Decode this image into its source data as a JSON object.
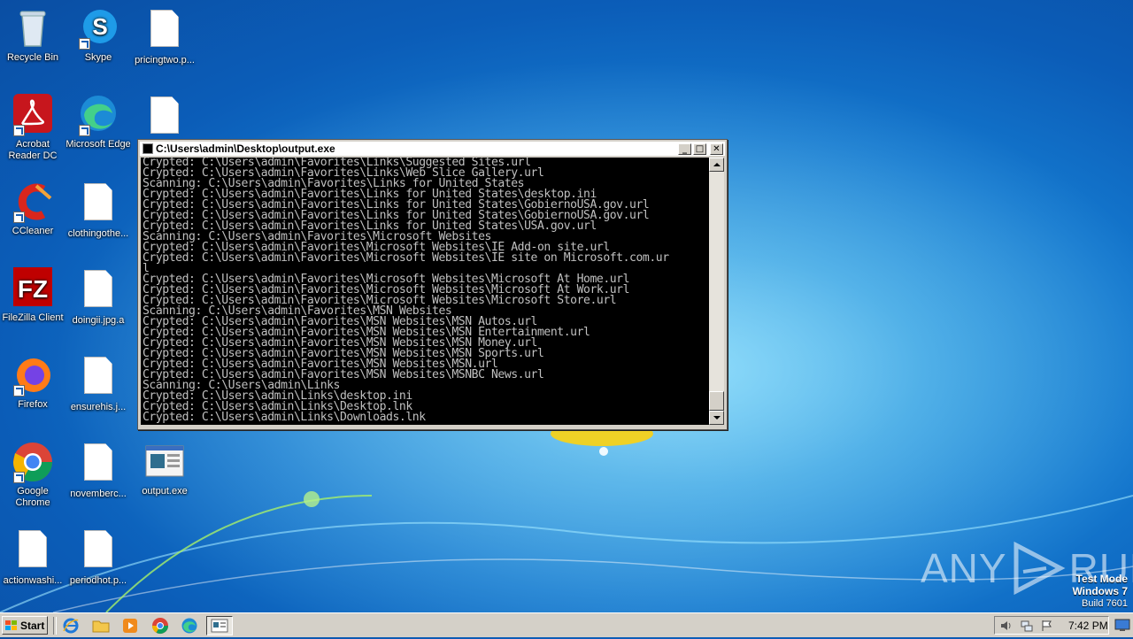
{
  "desktop": {
    "icons": [
      {
        "label": "Recycle Bin"
      },
      {
        "label": "Skype"
      },
      {
        "label": "pricingtwo.p..."
      },
      {
        "label": "Acrobat Reader DC"
      },
      {
        "label": "Microsoft Edge"
      },
      {
        "label": "CCleaner"
      },
      {
        "label": "clothingothe..."
      },
      {
        "label": "FileZilla Client"
      },
      {
        "label": "doingii.jpg.a"
      },
      {
        "label": "Firefox"
      },
      {
        "label": "ensurehis.j..."
      },
      {
        "label": "Google Chrome"
      },
      {
        "label": "novemberc..."
      },
      {
        "label": "output.exe"
      },
      {
        "label": "actionwashi..."
      },
      {
        "label": "periodhot.p..."
      }
    ]
  },
  "console": {
    "title": "C:\\Users\\admin\\Desktop\\output.exe",
    "lines": [
      "Crypted: C:\\Users\\admin\\Favorites\\Links\\Suggested Sites.url",
      "Crypted: C:\\Users\\admin\\Favorites\\Links\\Web Slice Gallery.url",
      "Scanning: C:\\Users\\admin\\Favorites\\Links for United States",
      "Crypted: C:\\Users\\admin\\Favorites\\Links for United States\\desktop.ini",
      "Crypted: C:\\Users\\admin\\Favorites\\Links for United States\\GobiernoUSA.gov.url",
      "Crypted: C:\\Users\\admin\\Favorites\\Links for United States\\GobiernoUSA.gov.url",
      "Crypted: C:\\Users\\admin\\Favorites\\Links for United States\\USA.gov.url",
      "Scanning: C:\\Users\\admin\\Favorites\\Microsoft Websites",
      "Crypted: C:\\Users\\admin\\Favorites\\Microsoft Websites\\IE Add-on site.url",
      "Crypted: C:\\Users\\admin\\Favorites\\Microsoft Websites\\IE site on Microsoft.com.ur",
      "l",
      "Crypted: C:\\Users\\admin\\Favorites\\Microsoft Websites\\Microsoft At Home.url",
      "Crypted: C:\\Users\\admin\\Favorites\\Microsoft Websites\\Microsoft At Work.url",
      "Crypted: C:\\Users\\admin\\Favorites\\Microsoft Websites\\Microsoft Store.url",
      "Scanning: C:\\Users\\admin\\Favorites\\MSN Websites",
      "Crypted: C:\\Users\\admin\\Favorites\\MSN Websites\\MSN Autos.url",
      "Crypted: C:\\Users\\admin\\Favorites\\MSN Websites\\MSN Entertainment.url",
      "Crypted: C:\\Users\\admin\\Favorites\\MSN Websites\\MSN Money.url",
      "Crypted: C:\\Users\\admin\\Favorites\\MSN Websites\\MSN Sports.url",
      "Crypted: C:\\Users\\admin\\Favorites\\MSN Websites\\MSN.url",
      "Crypted: C:\\Users\\admin\\Favorites\\MSN Websites\\MSNBC News.url",
      "Scanning: C:\\Users\\admin\\Links",
      "Crypted: C:\\Users\\admin\\Links\\desktop.ini",
      "Crypted: C:\\Users\\admin\\Links\\Desktop.lnk",
      "Crypted: C:\\Users\\admin\\Links\\Downloads.lnk"
    ]
  },
  "watermark": {
    "left": "ANY",
    "right": "RUN"
  },
  "os_info": {
    "line1": "Test Mode",
    "line2": "Windows 7",
    "line3": "Build 7601"
  },
  "taskbar": {
    "start_label": "Start",
    "clock": "7:42 PM"
  },
  "icons": {
    "start": "windows-flag-icon",
    "quicklaunch": [
      "internet-explorer-icon",
      "folder-icon",
      "media-player-icon",
      "chrome-icon",
      "edge-icon"
    ],
    "tray": [
      "volume-icon",
      "network-icon",
      "flag-icon"
    ]
  }
}
